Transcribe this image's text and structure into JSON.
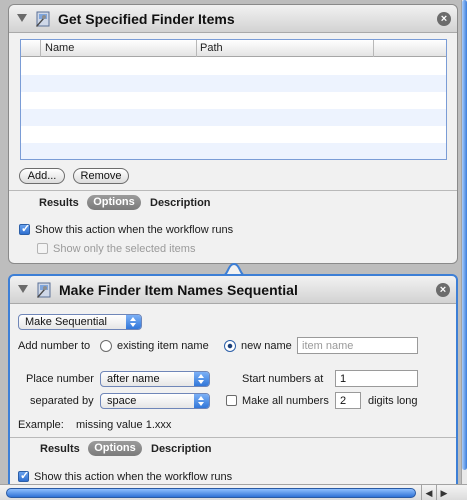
{
  "action1": {
    "title": "Get Specified Finder Items",
    "columns": [
      "Name",
      "Path"
    ],
    "add_label": "Add...",
    "remove_label": "Remove",
    "tabs": [
      "Results",
      "Options",
      "Description"
    ],
    "selected_tab": "Options",
    "show_action_label": "Show this action when the workflow runs",
    "show_action_checked": true,
    "show_selected_label": "Show only the selected items",
    "show_selected_checked": false
  },
  "action2": {
    "title": "Make Finder Item Names Sequential",
    "mode": "Make Sequential",
    "add_number_to_label": "Add number to",
    "existing_name_label": "existing item name",
    "new_name_label": "new name",
    "new_name_selected": true,
    "item_name_placeholder": "item name",
    "place_number_label": "Place number",
    "place_number_value": "after name",
    "start_numbers_label": "Start numbers at",
    "start_numbers_value": "1",
    "separated_by_label": "separated by",
    "separated_by_value": "space",
    "make_all_label": "Make all numbers",
    "make_all_checked": false,
    "digits_value": "2",
    "digits_long_label": "digits long",
    "example_label": "Example:",
    "example_value": "missing value 1.xxx",
    "tabs": [
      "Results",
      "Options",
      "Description"
    ],
    "selected_tab": "Options",
    "show_action_label": "Show this action when the workflow runs",
    "show_action_checked": true
  },
  "colors": {
    "accent": "#3d7fd6",
    "row_alt": "#edf3fe"
  },
  "icons": {
    "disclosure": "disclosure-triangle-icon",
    "app": "automator-finder-icon",
    "close": "close-icon"
  }
}
